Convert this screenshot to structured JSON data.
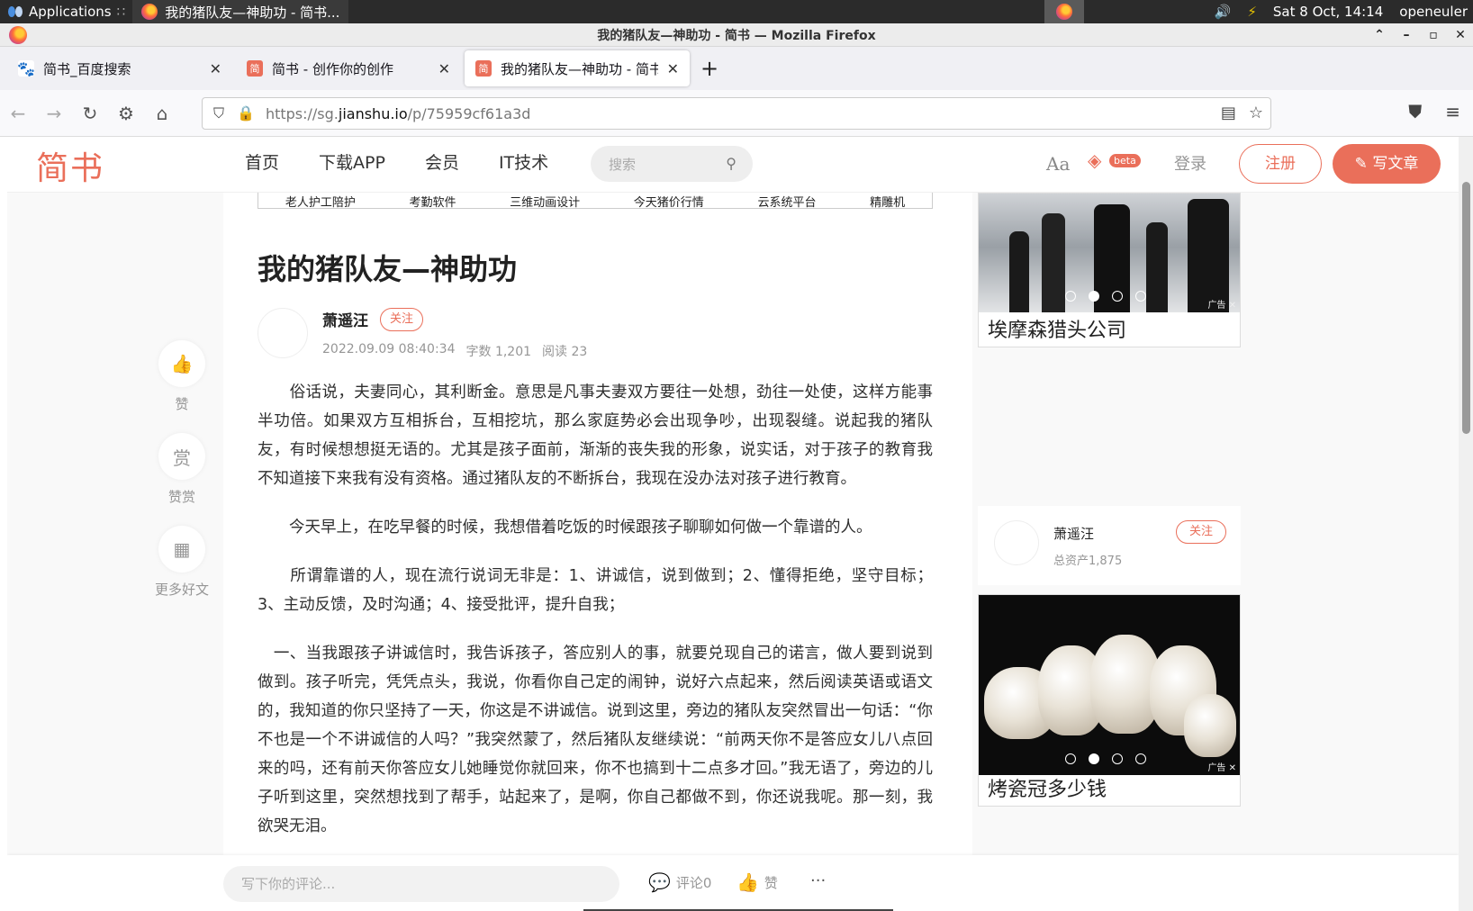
{
  "os": {
    "apps_label": "Applications",
    "task_title": "我的猪队友—神助功 - 简书...",
    "datetime": "Sat  8 Oct, 14:14",
    "user": "openeuler"
  },
  "window": {
    "title": "我的猪队友—神助功 - 简书 — Mozilla Firefox"
  },
  "tabs": [
    {
      "label": "简书_百度搜索",
      "favicon": "baidu-icon"
    },
    {
      "label": "简书 - 创作你的创作",
      "favicon": "jianshu-icon"
    },
    {
      "label": "我的猪队友—神助功 - 简书",
      "favicon": "jianshu-icon"
    }
  ],
  "url": {
    "prefix": "https://sg.",
    "domain": "jianshu.io",
    "path": "/p/75959cf61a3d"
  },
  "site": {
    "logo": "简书",
    "nav": [
      "首页",
      "下载APP",
      "会员",
      "IT技术"
    ],
    "search_placeholder": "搜索",
    "font_toggle": "Aa",
    "beta": "beta",
    "login": "登录",
    "register": "注册",
    "write": "写文章"
  },
  "tags": [
    "老人护工陪护",
    "考勤软件",
    "三维动画设计",
    "今天猪价行情",
    "云系统平台",
    "精雕机"
  ],
  "article": {
    "title": "我的猪队友—神助功",
    "author": "萧遥汪",
    "follow": "关注",
    "date": "2022.09.09 08:40:34",
    "words": "字数 1,201",
    "reads": "阅读 23",
    "paragraphs": [
      "　　俗话说，夫妻同心，其利断金。意思是凡事夫妻双方要往一处想，劲往一处使，这样方能事半功倍。如果双方互相拆台，互相挖坑，那么家庭势必会出现争吵，出现裂缝。说起我的猪队友，有时候想想挺无语的。尤其是孩子面前，渐渐的丧失我的形象，说实话，对于孩子的教育我不知道接下来我有没有资格。通过猪队友的不断拆台，我现在没办法对孩子进行教育。",
      "　　今天早上，在吃早餐的时候，我想借着吃饭的时候跟孩子聊聊如何做一个靠谱的人。",
      "　　所谓靠谱的人，现在流行说词无非是：1、讲诚信，说到做到；2、懂得拒绝，坚守目标；3、主动反馈，及时沟通；4、接受批评，提升自我；",
      "　一、当我跟孩子讲诚信时，我告诉孩子，答应别人的事，就要兑现自己的诺言，做人要到说到做到。孩子听完，凭凭点头，我说，你看你自己定的闹钟，说好六点起来，然后阅读英语或语文的，我知道的你只坚持了一天，你这是不讲诚信。说到这里，旁边的猪队友突然冒出一句话：“你不也是一个不讲诚信的人吗？”我突然蒙了，然后猪队友继续说：“前两天你不是答应女儿八点回来的吗，还有前天你答应女儿她睡觉你就回来，你不也搞到十二点多才回。”我无语了，旁边的儿子听到这里，突然想找到了帮手，站起来了，是啊，你自己都做不到，你还说我呢。那一刻，我欲哭无泪。"
    ]
  },
  "side_actions": [
    {
      "label": "赞",
      "icon": "thumbs-up-icon"
    },
    {
      "label": "赞赏",
      "glyph": "赏"
    },
    {
      "label": "更多好文",
      "icon": "qrcode-icon"
    }
  ],
  "ads": [
    {
      "caption": "埃摩森猎头公司",
      "mark": "广告"
    },
    {
      "caption": "烤瓷冠多少钱",
      "mark": "广告"
    }
  ],
  "author_card": {
    "name": "萧遥汪",
    "assets": "总资产1,875",
    "follow": "关注"
  },
  "comment_bar": {
    "placeholder": "写下你的评论...",
    "comments": "评论0",
    "like": "赞",
    "more": "···"
  }
}
